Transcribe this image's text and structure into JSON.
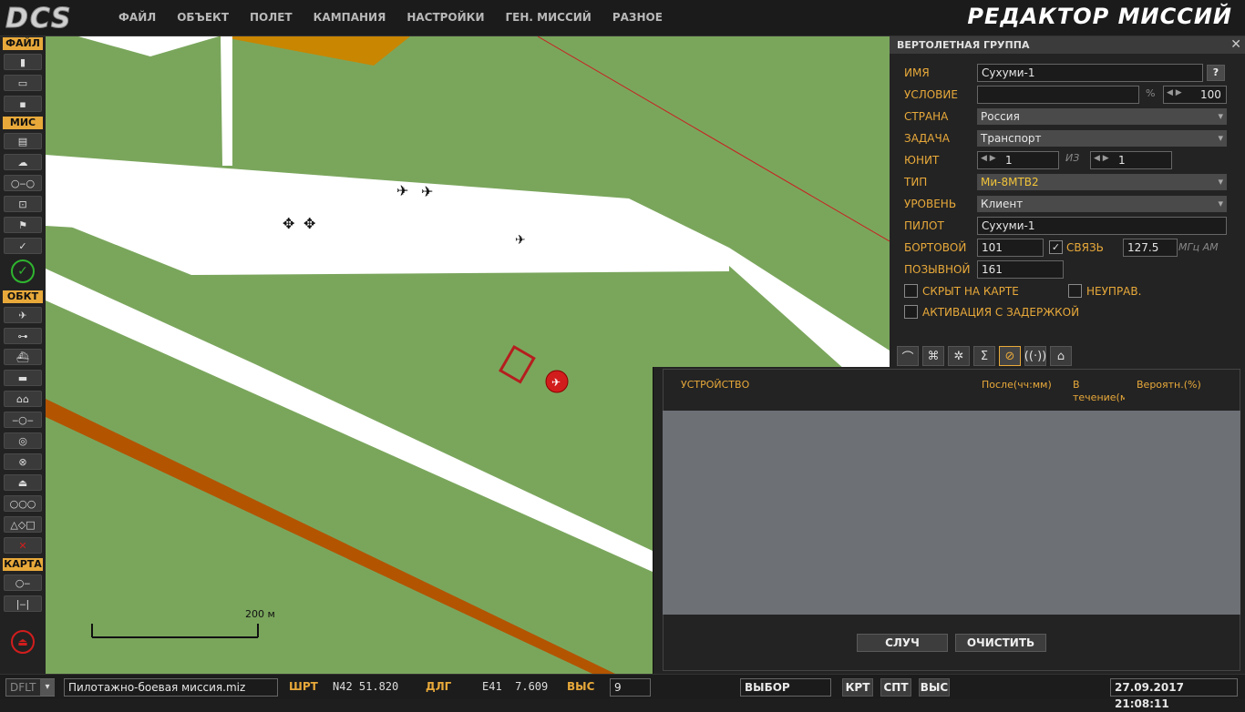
{
  "app": {
    "logo": "DCS",
    "title": "РЕДАКТОР МИССИЙ"
  },
  "menu": [
    "ФАЙЛ",
    "ОБЪЕКТ",
    "ПОЛЕТ",
    "КАМПАНИЯ",
    "НАСТРОЙКИ",
    "ГЕН. МИССИЙ",
    "РАЗНОЕ"
  ],
  "left": {
    "file": "ФАЙЛ",
    "mission": "МИС",
    "objects": "ОБКТ",
    "map": "КАРТА"
  },
  "map": {
    "scale_label": "200 м"
  },
  "panel": {
    "title": "ВЕРТОЛЕТНАЯ ГРУППА",
    "close": "✕",
    "name_label": "ИМЯ",
    "name_value": "Сухуми-1",
    "help": "?",
    "condition_label": "УСЛОВИЕ",
    "condition_value": "",
    "percent": "%",
    "probability": "100",
    "country_label": "СТРАНА",
    "country_value": "Россия",
    "task_label": "ЗАДАЧА",
    "task_value": "Транспорт",
    "unit_label": "ЮНИТ",
    "unit_value": "1",
    "of_label": "ИЗ",
    "unit_total": "1",
    "type_label": "ТИП",
    "type_value": "Ми-8МТВ2",
    "skill_label": "УРОВЕНЬ",
    "skill_value": "Клиент",
    "pilot_label": "ПИЛОТ",
    "pilot_value": "Сухуми-1",
    "tail_label": "БОРТОВОЙ",
    "tail_value": "101",
    "radio_label": "СВЯЗЬ",
    "radio_value": "127.5",
    "radio_unit": "МГц АМ",
    "callsign_label": "ПОЗЫВНОЙ",
    "callsign_value": "161",
    "hidden_label": "СКРЫТ НА КАРТЕ",
    "uncontrolled_label": "НЕУПРАВ.",
    "late_label": "АКТИВАЦИЯ С ЗАДЕРЖКОЙ"
  },
  "failures": {
    "col_device": "УСТРОЙСТВО",
    "col_after": "После(чч:мм)",
    "col_during_1": "В",
    "col_during_2": "течение(м",
    "col_prob": "Вероятн.(%)",
    "random_btn": "СЛУЧ",
    "clear_btn": "ОЧИСТИТЬ"
  },
  "status": {
    "dflt": "DFLT",
    "filename": "Пилотажно-боевая миссия.miz",
    "lat_label": "ШРТ",
    "lat_value": "N42 51.820",
    "lon_label": "ДЛГ",
    "lon_value": "E41  7.609",
    "alt_label": "ВЫС",
    "alt_value": "9",
    "select_value": "ВЫБОР",
    "btn_map": "КРТ",
    "btn_sat": "СПТ",
    "btn_alt": "ВЫС",
    "datetime": "27.09.2017 21:08:11"
  },
  "colors": {
    "accent": "#e8a93a",
    "map_green": "#7aa65c",
    "road_brown": "#b35400",
    "panel_bg": "#232323"
  }
}
